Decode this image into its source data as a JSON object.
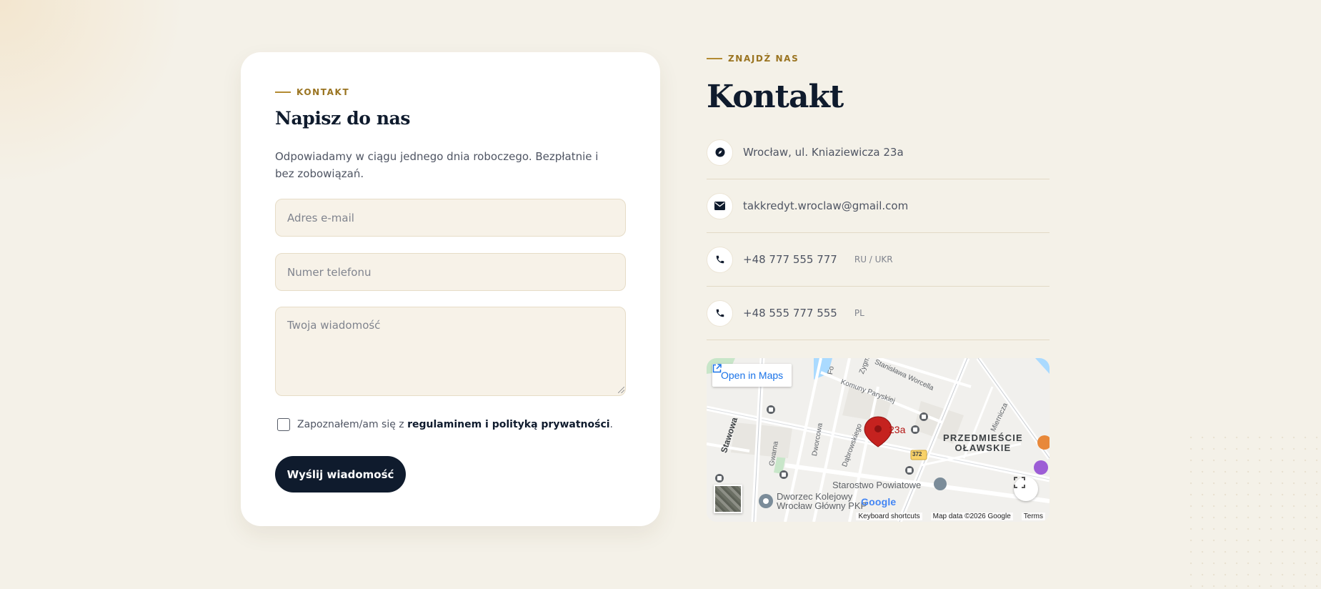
{
  "form": {
    "eyebrow": "KONTAKT",
    "title": "Napisz do nas",
    "description": "Odpowiadamy w ciągu jednego dnia roboczego. Bezpłatnie i bez zobowiązań.",
    "email_placeholder": "Adres e-mail",
    "phone_placeholder": "Numer telefonu",
    "message_placeholder": "Twoja wiadomość",
    "consent_prefix": "Zapoznałem/am się z ",
    "consent_link": "regulaminem i polityką prywatności",
    "consent_suffix": ".",
    "consent_checked": false,
    "submit_label": "Wyślij wiadomość"
  },
  "contact": {
    "eyebrow": "ZNAJDŹ NAS",
    "title": "Kontakt",
    "items": [
      {
        "icon": "compass-icon",
        "text": "Wrocław, ul. Kniaziewicza 23a",
        "tag": ""
      },
      {
        "icon": "envelope-icon",
        "text": "takkredyt.wroclaw@gmail.com",
        "tag": ""
      },
      {
        "icon": "phone-icon",
        "text": "+48 777 555 777",
        "tag": "RU / UKR"
      },
      {
        "icon": "phone-icon",
        "text": "+48 555 777 555",
        "tag": "PL"
      }
    ]
  },
  "map": {
    "open_in_maps": "Open in Maps",
    "pin_label": "23a",
    "district_line1": "PRZEDMIEŚCIE",
    "district_line2": "OŁAWSKIE",
    "street_labels": {
      "stawowa": "Stawowa",
      "gwarna": "Gwarna",
      "dworcowa": "Dworcowa",
      "dabrowskiego": "Dąbrowskiego",
      "komuny": "Komuny Paryskiej",
      "worcella": "Stanisława Worcella",
      "miernicza": "Miernicza",
      "zyg": "Zygm",
      "fo": "Fo"
    },
    "road_badge": "372",
    "poi_starostwo": "Starostwo Powiatowe",
    "poi_dworzec_line1": "Dworzec Kolejowy",
    "poi_dworzec_line2": "Wrocław Główny PKP",
    "google": "Google",
    "keyboard_shortcuts": "Keyboard shortcuts",
    "map_data": "Map data ©2026 Google",
    "terms": "Terms",
    "colors": {
      "pin": "#c5221f",
      "water": "#aadaff",
      "park": "#c8e6c9"
    }
  }
}
